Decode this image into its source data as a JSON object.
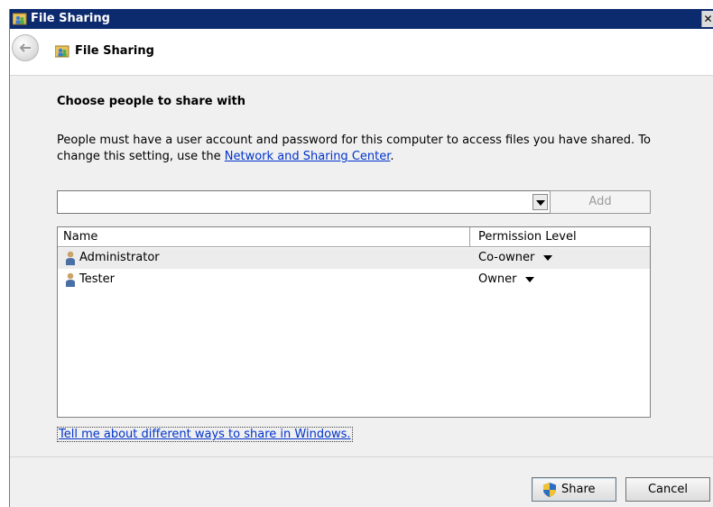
{
  "window": {
    "title": "File Sharing",
    "close_glyph": "✕"
  },
  "nav": {
    "title": "File Sharing",
    "back_icon": "back-arrow-icon"
  },
  "main": {
    "heading": "Choose people to share with",
    "description_part1": "People must have a user account and password for this computer to access files you have shared.  To change this setting, use the ",
    "description_link": "Network and Sharing Center",
    "description_part2": ".",
    "combo": {
      "value": "",
      "placeholder": ""
    },
    "add_label": "Add",
    "table": {
      "columns": [
        "Name",
        "Permission Level"
      ],
      "rows": [
        {
          "name": "Administrator",
          "permission": "Co-owner"
        },
        {
          "name": "Tester",
          "permission": "Owner"
        }
      ]
    },
    "help_link": "Tell me about different ways to share in Windows."
  },
  "footer": {
    "share_label": "Share",
    "cancel_label": "Cancel"
  },
  "colors": {
    "titlebar": "#0c2a6e",
    "link": "#0033cc",
    "selected_row": "#ececec"
  }
}
